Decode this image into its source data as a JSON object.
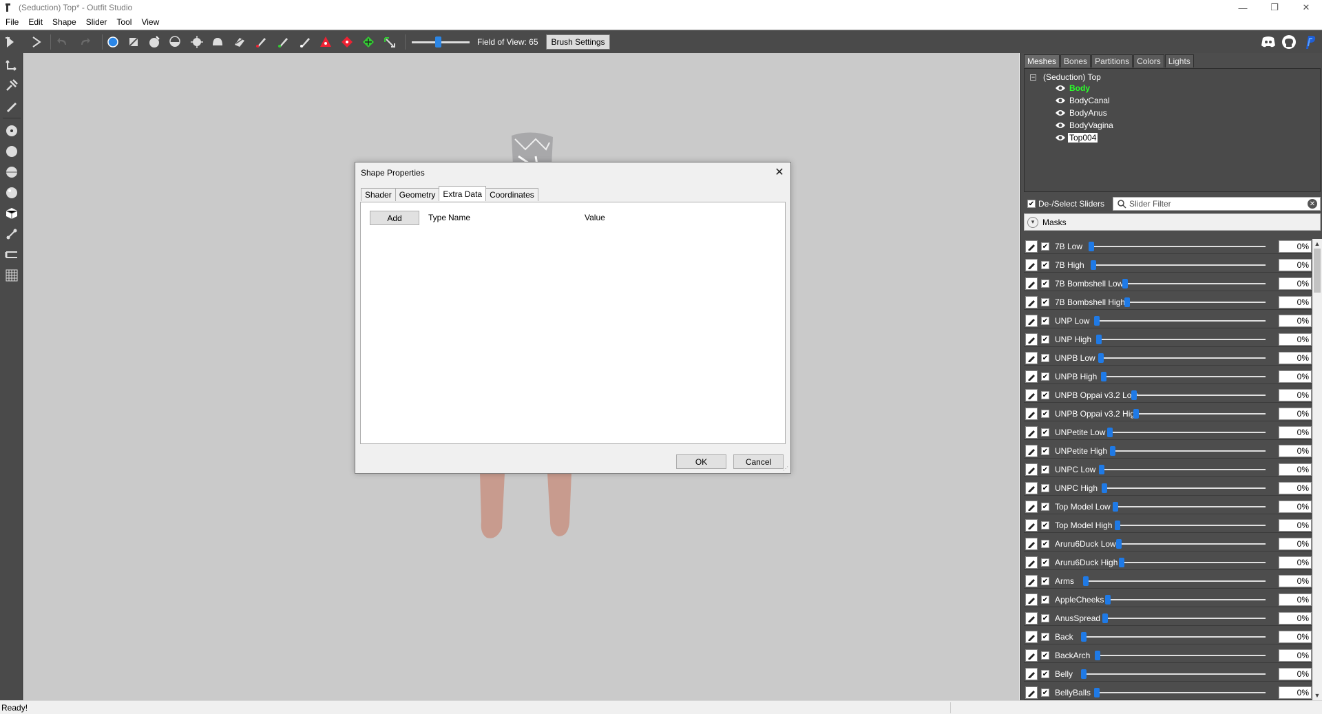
{
  "window": {
    "title": "(Seduction) Top* - Outfit Studio",
    "minimize": "—",
    "maximize": "❐",
    "close": "✕"
  },
  "menu": [
    "File",
    "Edit",
    "Shape",
    "Slider",
    "Tool",
    "View"
  ],
  "toolbar": {
    "fov_label": "Field of View: 65",
    "fov_value": 65,
    "brush_settings": "Brush Settings"
  },
  "panel": {
    "tabs": [
      "Meshes",
      "Bones",
      "Partitions",
      "Colors",
      "Lights"
    ],
    "active_tab": "Meshes",
    "tree": {
      "expander": "−",
      "root": "(Seduction) Top",
      "items": [
        "Body",
        "BodyCanal",
        "BodyAnus",
        "BodyVagina",
        "Top004"
      ],
      "active_item": "Body",
      "selected_item": "Top004"
    },
    "deselect_label": "De-/Select Sliders",
    "filter_placeholder": "Slider Filter",
    "masks_label": "Masks",
    "sliders": [
      {
        "name": "7B Low",
        "value": "0%"
      },
      {
        "name": "7B High",
        "value": "0%"
      },
      {
        "name": "7B Bombshell Low",
        "value": "0%"
      },
      {
        "name": "7B Bombshell High",
        "value": "0%"
      },
      {
        "name": "UNP Low",
        "value": "0%"
      },
      {
        "name": "UNP High",
        "value": "0%"
      },
      {
        "name": "UNPB Low",
        "value": "0%"
      },
      {
        "name": "UNPB High",
        "value": "0%"
      },
      {
        "name": "UNPB Oppai v3.2 Low",
        "value": "0%"
      },
      {
        "name": "UNPB Oppai v3.2 High",
        "value": "0%"
      },
      {
        "name": "UNPetite Low",
        "value": "0%"
      },
      {
        "name": "UNPetite High",
        "value": "0%"
      },
      {
        "name": "UNPC Low",
        "value": "0%"
      },
      {
        "name": "UNPC High",
        "value": "0%"
      },
      {
        "name": "Top Model Low",
        "value": "0%"
      },
      {
        "name": "Top Model High",
        "value": "0%"
      },
      {
        "name": "Aruru6Duck Low",
        "value": "0%"
      },
      {
        "name": "Aruru6Duck High",
        "value": "0%"
      },
      {
        "name": "Arms",
        "value": "0%"
      },
      {
        "name": "AppleCheeks",
        "value": "0%"
      },
      {
        "name": "AnusSpread",
        "value": "0%"
      },
      {
        "name": "Back",
        "value": "0%"
      },
      {
        "name": "BackArch",
        "value": "0%"
      },
      {
        "name": "Belly",
        "value": "0%"
      },
      {
        "name": "BellyBalls",
        "value": "0%"
      }
    ]
  },
  "dialog": {
    "title": "Shape Properties",
    "close": "✕",
    "tabs": [
      "Shader",
      "Geometry",
      "Extra Data",
      "Coordinates"
    ],
    "active_tab": "Extra Data",
    "add_label": "Add",
    "columns": {
      "type": "Type",
      "name": "Name",
      "value": "Value"
    },
    "ok": "OK",
    "cancel": "Cancel"
  },
  "status": {
    "text": "Ready!"
  },
  "colors": {
    "toolbar_bg": "#4a4a4a",
    "viewport_bg": "#cacaca",
    "accent_blue": "#1f7ae6",
    "active_mesh": "#2aff2a"
  },
  "icons": {
    "toolbar": [
      "select-icon",
      "transform-icon",
      "undo-icon",
      "redo-icon",
      "brush-standard-icon",
      "brush-mask-icon",
      "brush-inflate-icon",
      "brush-deflate-icon",
      "brush-move-icon",
      "brush-smooth-icon",
      "brush-undiff-icon",
      "brush-weight-icon",
      "brush-color-icon",
      "brush-alpha-icon",
      "pivot-icon",
      "vertex-select-icon",
      "collapse-icon",
      "flip-icon"
    ],
    "left": [
      "transform-tool-icon",
      "pivot-tool-icon",
      "pen-tool-icon",
      "brush-size-1-icon",
      "brush-size-2-icon",
      "brush-size-3-icon",
      "brush-size-4-icon",
      "cube-icon",
      "bone-icon",
      "flip-tool-icon",
      "grid-icon"
    ]
  }
}
